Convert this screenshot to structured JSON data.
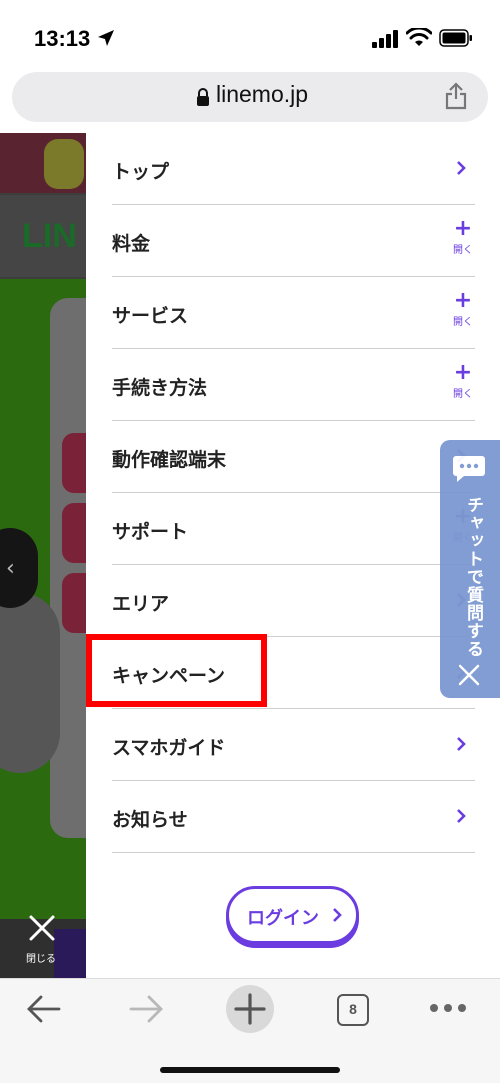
{
  "status_bar": {
    "time": "13:13",
    "icons": [
      "location-arrow-icon",
      "cellular-signal-icon",
      "wifi-icon",
      "battery-icon"
    ]
  },
  "address_bar": {
    "url": "linemo.jp",
    "icons": [
      "lock-icon",
      "share-icon"
    ]
  },
  "background_page": {
    "logo_fragment": "LIN",
    "close_label": "閉じる"
  },
  "menu": {
    "items": [
      {
        "label": "トップ",
        "action": "chevron"
      },
      {
        "label": "料金",
        "action": "expand",
        "expand_label": "開く"
      },
      {
        "label": "サービス",
        "action": "expand",
        "expand_label": "開く"
      },
      {
        "label": "手続き方法",
        "action": "expand",
        "expand_label": "開く"
      },
      {
        "label": "動作確認端末",
        "action": "chevron"
      },
      {
        "label": "サポート",
        "action": "expand",
        "expand_label": "開く"
      },
      {
        "label": "エリア",
        "action": "chevron"
      },
      {
        "label": "キャンペーン",
        "action": "chevron",
        "highlighted": true
      },
      {
        "label": "スマホガイド",
        "action": "chevron"
      },
      {
        "label": "お知らせ",
        "action": "chevron"
      }
    ],
    "plus_glyph": "+",
    "login_label": "ログイン"
  },
  "chat_tab": {
    "label": "チャットで質問する"
  },
  "toolbar": {
    "tab_count": "8",
    "icons": [
      "back-arrow-icon",
      "forward-arrow-icon",
      "new-tab-plus-icon",
      "tabs-icon",
      "more-icon"
    ]
  },
  "colors": {
    "accent": "#6b3de0",
    "highlight": "#ff0000",
    "chat_tab": "#7b98d1"
  }
}
